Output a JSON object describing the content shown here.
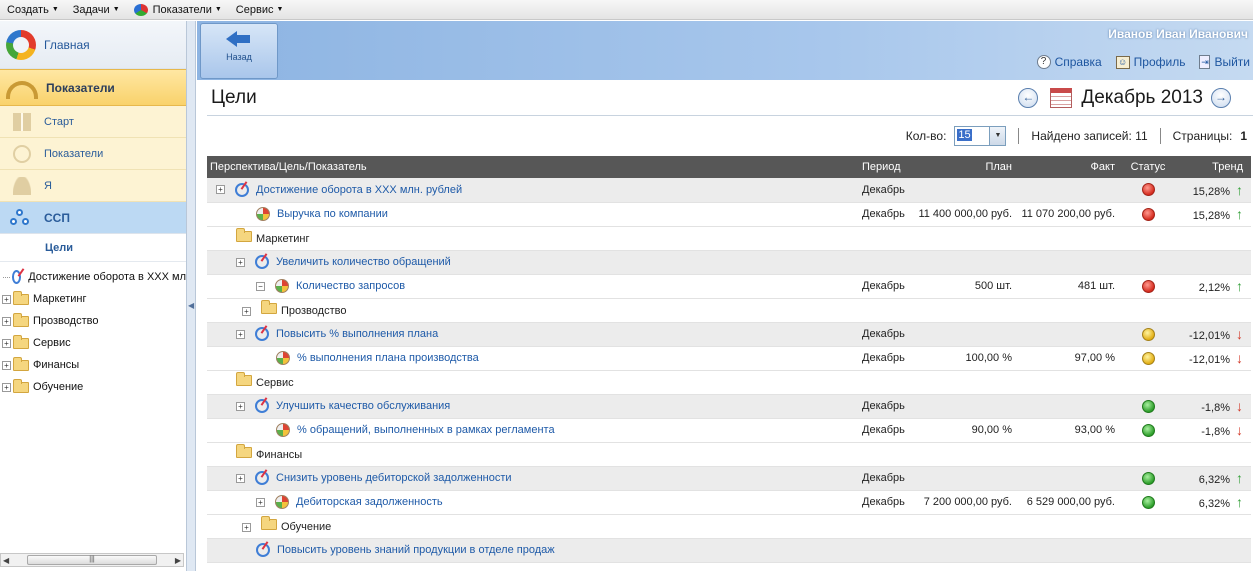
{
  "menubar": {
    "items": [
      "Создать",
      "Задачи",
      "Показатели",
      "Сервис"
    ]
  },
  "sidebar": {
    "main": "Главная",
    "indicators": "Показатели",
    "sub": [
      "Старт",
      "Показатели",
      "Я"
    ],
    "ssp": "ССП",
    "goals_header": "Цели",
    "tree": [
      "Достижение оборота в XXX мл",
      "Маркетинг",
      "Прозводство",
      "Сервис",
      "Финансы",
      "Обучение"
    ]
  },
  "header": {
    "back": "Назад",
    "user": "Иванов Иван Иванович",
    "help": "Справка",
    "profile": "Профиль",
    "logout": "Выйти"
  },
  "page": {
    "title": "Цели",
    "period": "Декабрь 2013"
  },
  "pager": {
    "count_label": "Кол-во:",
    "count_value": "15",
    "found": "Найдено записей: 11",
    "pages_label": "Страницы:",
    "pages_value": "1"
  },
  "table": {
    "headers": [
      "Перспектива/Цель/Показатель",
      "Период",
      "План",
      "Факт",
      "Статус",
      "Тренд"
    ],
    "rows": [
      {
        "name": "Достижение оборота в XXX млн. рублей",
        "period": "Декабрь",
        "plan": "",
        "fact": "",
        "status": "red",
        "trend": "15,28%",
        "dir": "up"
      },
      {
        "name": "Выручка по компании",
        "period": "Декабрь",
        "plan": "11 400 000,00 руб.",
        "fact": "11 070 200,00 руб.",
        "status": "red",
        "trend": "15,28%",
        "dir": "up"
      },
      {
        "name": "Маркетинг",
        "period": "",
        "plan": "",
        "fact": "",
        "status": "",
        "trend": "",
        "dir": ""
      },
      {
        "name": "Увеличить количество обращений",
        "period": "",
        "plan": "",
        "fact": "",
        "status": "",
        "trend": "",
        "dir": ""
      },
      {
        "name": "Количество запросов",
        "period": "Декабрь",
        "plan": "500 шт.",
        "fact": "481 шт.",
        "status": "red",
        "trend": "2,12%",
        "dir": "up"
      },
      {
        "name": "Прозводство",
        "period": "",
        "plan": "",
        "fact": "",
        "status": "",
        "trend": "",
        "dir": ""
      },
      {
        "name": "Повысить % выполнения плана",
        "period": "Декабрь",
        "plan": "",
        "fact": "",
        "status": "yel",
        "trend": "-12,01%",
        "dir": "down"
      },
      {
        "name": "% выполнения плана производства",
        "period": "Декабрь",
        "plan": "100,00 %",
        "fact": "97,00 %",
        "status": "yel",
        "trend": "-12,01%",
        "dir": "down"
      },
      {
        "name": "Сервис",
        "period": "",
        "plan": "",
        "fact": "",
        "status": "",
        "trend": "",
        "dir": ""
      },
      {
        "name": "Улучшить качество обслуживания",
        "period": "Декабрь",
        "plan": "",
        "fact": "",
        "status": "grn",
        "trend": "-1,8%",
        "dir": "down"
      },
      {
        "name": "% обращений, выполненных в рамках регламента",
        "period": "Декабрь",
        "plan": "90,00 %",
        "fact": "93,00 %",
        "status": "grn",
        "trend": "-1,8%",
        "dir": "down"
      },
      {
        "name": "Финансы",
        "period": "",
        "plan": "",
        "fact": "",
        "status": "",
        "trend": "",
        "dir": ""
      },
      {
        "name": "Снизить уровень дебиторской задолженности",
        "period": "Декабрь",
        "plan": "",
        "fact": "",
        "status": "grn",
        "trend": "6,32%",
        "dir": "up"
      },
      {
        "name": "Дебиторская задолженность",
        "period": "Декабрь",
        "plan": "7 200 000,00 руб.",
        "fact": "6 529 000,00 руб.",
        "status": "grn",
        "trend": "6,32%",
        "dir": "up"
      },
      {
        "name": "Обучение",
        "period": "",
        "plan": "",
        "fact": "",
        "status": "",
        "trend": "",
        "dir": ""
      },
      {
        "name": "Повысить уровень знаний продукции в отделе продаж",
        "period": "",
        "plan": "",
        "fact": "",
        "status": "",
        "trend": "",
        "dir": ""
      }
    ]
  },
  "icons": {
    "up": "↑",
    "down": "↓",
    "plus": "+",
    "minus": "−"
  }
}
